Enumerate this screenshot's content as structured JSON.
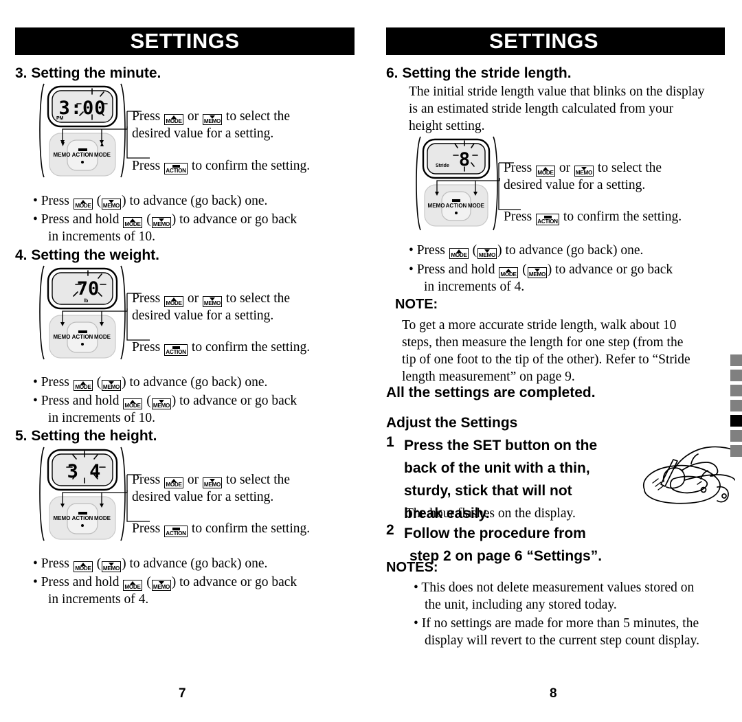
{
  "document": {
    "banner_title": "SETTINGS",
    "page_numbers": {
      "left": "7",
      "right": "8"
    }
  },
  "common": {
    "press_word": "Press",
    "press_and_hold_word": "Press and hold",
    "or_word": "or",
    "select_text": "to select the",
    "select_text2": "desired value for a setting.",
    "confirm_text": "to confirm the setting.",
    "advance_text": "to advance (go back) one.",
    "advance_back_text": "to advance or go back",
    "keys": {
      "mode": "MODE",
      "memo": "MEMO",
      "action": "ACTION"
    }
  },
  "left_page": {
    "section3": {
      "heading": "3. Setting the minute.",
      "display": {
        "value": "3:00",
        "indicator": "PM"
      },
      "increment_line": "in increments of 10."
    },
    "section4": {
      "heading": "4. Setting the weight.",
      "display": {
        "value": "70",
        "indicator": "lb"
      },
      "increment_line": "in increments of 10."
    },
    "section5": {
      "heading": "5. Setting the height.",
      "display": {
        "value": "3 4",
        "indicator": ""
      },
      "increment_line": "in increments of 4."
    }
  },
  "right_page": {
    "section6": {
      "heading": "6. Setting the stride length.",
      "intro_lines": [
        "The initial stride length value that blinks on the display",
        "is an estimated stride length calculated from your",
        "height setting."
      ],
      "display": {
        "value": "8",
        "indicator": "Stride"
      },
      "increment_line": "in increments of 4."
    },
    "note": {
      "label": "NOTE:",
      "lines": [
        "To get a more accurate stride length, walk about 10",
        "steps, then measure the length for one step (from the",
        "tip of one foot to the tip of the other). Refer to “Stride",
        "length measurement” on page 9."
      ]
    },
    "completed_heading": "All the settings are completed.",
    "adjust": {
      "heading": "Adjust the Settings",
      "step1_number": "1",
      "step1_lines": [
        "Press the SET button on the",
        "back of the unit with a thin,",
        "sturdy, stick that will not",
        "break easily."
      ],
      "step1_sub": "The hour flashes on the display.",
      "step2_number": "2",
      "step2_lines": [
        "Follow the procedure from",
        "step 2 on page 6 “Settings”."
      ]
    },
    "notes": {
      "label": "NOTES:",
      "items": [
        [
          "This does not delete measurement values stored on",
          "the unit, including any stored today."
        ],
        [
          "If no settings are made for more than 5 minutes, the",
          "display will revert to the current step count display."
        ]
      ]
    }
  },
  "margin_tabs": {
    "count": 7,
    "current_index": 4,
    "color": "#808080",
    "current_color": "#000000"
  }
}
